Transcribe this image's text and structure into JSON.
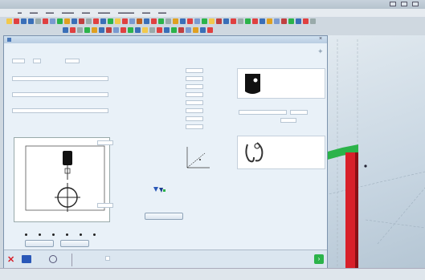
{
  "dialog": {
    "title": "",
    "close_glyph": "×",
    "left": {
      "fields": [
        {
          "label": "",
          "value": ""
        },
        {
          "label": "",
          "value": ""
        },
        {
          "label": "",
          "value": ""
        }
      ],
      "top_inputs": [
        "",
        "",
        ""
      ],
      "button_left": "",
      "button_right": ""
    },
    "params": {
      "rows": [
        {
          "label": "",
          "value": "",
          "unit": ""
        },
        {
          "label": "",
          "value": "",
          "unit": ""
        },
        {
          "label": "",
          "value": "",
          "unit": ""
        },
        {
          "label": "",
          "value": "",
          "unit": ""
        },
        {
          "label": "",
          "value": "",
          "unit": ""
        },
        {
          "label": "",
          "value": "",
          "unit": ""
        },
        {
          "label": "",
          "value": "",
          "unit": ""
        },
        {
          "label": "",
          "value": "",
          "unit": ""
        }
      ],
      "header": {
        "left": "",
        "right": ""
      }
    },
    "mid_icon_label": "",
    "mid_button": "",
    "right": {
      "section1_title": "",
      "section1_item": "",
      "section2_title": "",
      "section2_value": "",
      "section3_title": "",
      "section3_item": ""
    },
    "footer": {
      "text1": "",
      "text2": ""
    }
  },
  "statusbar": {
    "text1": "",
    "text2": ""
  },
  "schematic": {
    "top_input": "",
    "bottom_input": ""
  },
  "colors": {
    "accent_green": "#2bb34a",
    "accent_red": "#d8202a",
    "icon_blue": "#2a58b8"
  }
}
